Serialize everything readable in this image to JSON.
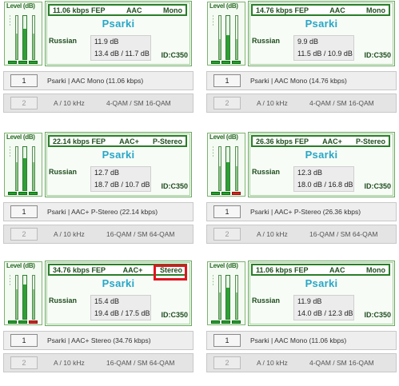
{
  "level_title": "Level (dB)",
  "panels": [
    {
      "header": {
        "bitrate": "11.06 kbps FEP",
        "codec": "AAC",
        "mode": "Mono"
      },
      "station": "Psarki",
      "language": "Russian",
      "snr_main": "11.9 dB",
      "snr_sub": "13.4 dB / 11.7 dB",
      "id": "ID:C350",
      "service_button": "1",
      "service_text": "Psarki  |  AAC Mono (11.06 kbps)",
      "second_button": "2",
      "modulation": "A / 10 kHz",
      "qam": "4-QAM / SM 16-QAM",
      "level": 0.7
    },
    {
      "header": {
        "bitrate": "14.76 kbps FEP",
        "codec": "AAC",
        "mode": "Mono"
      },
      "station": "Psarki",
      "language": "Russian",
      "snr_main": "9.9 dB",
      "snr_sub": "11.5 dB / 10.9 dB",
      "id": "ID:C350",
      "service_button": "1",
      "service_text": "Psarki  |  AAC Mono (14.76 kbps)",
      "second_button": "2",
      "modulation": "A / 10 kHz",
      "qam": "4-QAM / SM 16-QAM",
      "level": 0.55
    },
    {
      "header": {
        "bitrate": "22.14 kbps FEP",
        "codec": "AAC+",
        "mode": "P-Stereo"
      },
      "station": "Psarki",
      "language": "Russian",
      "snr_main": "12.7 dB",
      "snr_sub": "18.7 dB / 10.7 dB",
      "id": "ID:C350",
      "service_button": "1",
      "service_text": "Psarki  |  AAC+ P-Stereo (22.14 kbps)",
      "second_button": "2",
      "modulation": "A / 10 kHz",
      "qam": "16-QAM / SM 64-QAM",
      "level": 0.75
    },
    {
      "header": {
        "bitrate": "26.36 kbps FEP",
        "codec": "AAC+",
        "mode": "P-Stereo"
      },
      "station": "Psarki",
      "language": "Russian",
      "snr_main": "12.3 dB",
      "snr_sub": "18.0 dB / 16.8 dB",
      "id": "ID:C350",
      "service_button": "1",
      "service_text": "Psarki  |  AAC+ P-Stereo (26.36 kbps)",
      "second_button": "2",
      "modulation": "A / 10 kHz",
      "qam": "16-QAM / SM 64-QAM",
      "level": 0.65
    },
    {
      "header": {
        "bitrate": "34.76 kbps FEP",
        "codec": "AAC+",
        "mode": "Stereo"
      },
      "station": "Psarki",
      "language": "Russian",
      "snr_main": "15.4 dB",
      "snr_sub": "19.4 dB / 17.5 dB",
      "id": "ID:C350",
      "service_button": "1",
      "service_text": "Psarki  |  AAC+ Stereo (34.76 kbps)",
      "second_button": "2",
      "modulation": "A / 10 kHz",
      "qam": "16-QAM / SM 64-QAM",
      "level": 0.8
    },
    {
      "header": {
        "bitrate": "11.06 kbps FEP",
        "codec": "AAC",
        "mode": "Mono"
      },
      "station": "Psarki",
      "language": "Russian",
      "snr_main": "11.9 dB",
      "snr_sub": "14.0 dB / 12.3 dB",
      "id": "ID:C350",
      "service_button": "1",
      "service_text": "Psarki  |  AAC Mono (11.06 kbps)",
      "second_button": "2",
      "modulation": "A / 10 kHz",
      "qam": "4-QAM / SM 16-QAM",
      "level": 0.72
    }
  ],
  "colors": {
    "accent_green": "#2a7d2a",
    "station_cyan": "#28a6c8",
    "highlight_red": "#e0141e",
    "bar_red": "#d9221c"
  }
}
